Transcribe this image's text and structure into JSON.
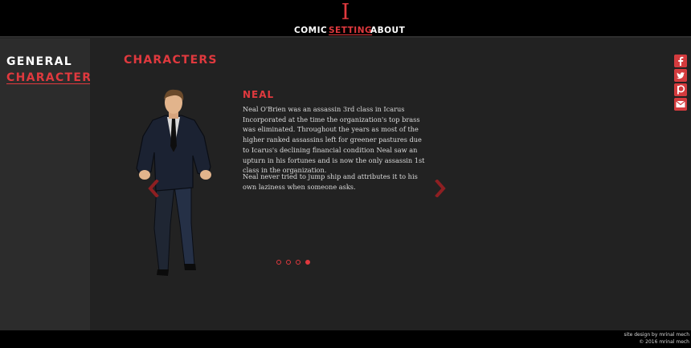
{
  "header": {
    "logo": "I",
    "nav": [
      {
        "label": "Comic",
        "active": false
      },
      {
        "label": "Setting",
        "active": true
      },
      {
        "label": "About",
        "active": false
      }
    ]
  },
  "sidebar": {
    "items": [
      {
        "label": "General",
        "active": false
      },
      {
        "label": "Characters",
        "active": true
      }
    ]
  },
  "main": {
    "title": "Characters",
    "character": {
      "name": "Neal",
      "bio": [
        "Neal O'Brien was an assassin 3rd class in Icarus Incorporated at the time the organization's top brass was eliminated. Throughout the years as most of the higher ranked assassins left for greener pastures due to Icarus's declining financial condition Neal saw an upturn in his fortunes and is now the only assassin 1st class in the organization.",
        "Neal never tried to jump ship and attributes it to his own laziness when someone asks."
      ]
    },
    "carousel": {
      "total": 4,
      "active_index": 3
    }
  },
  "social": [
    "facebook-icon",
    "twitter-icon",
    "patreon-icon",
    "mail-icon"
  ],
  "footer": {
    "credit": "site design by mrinal mech",
    "copyright": "© 2016 mrinal mech"
  },
  "colors": {
    "accent": "#e0393e",
    "background": "#222222",
    "sidebar": "#2c2c2c",
    "bar": "#000000"
  }
}
